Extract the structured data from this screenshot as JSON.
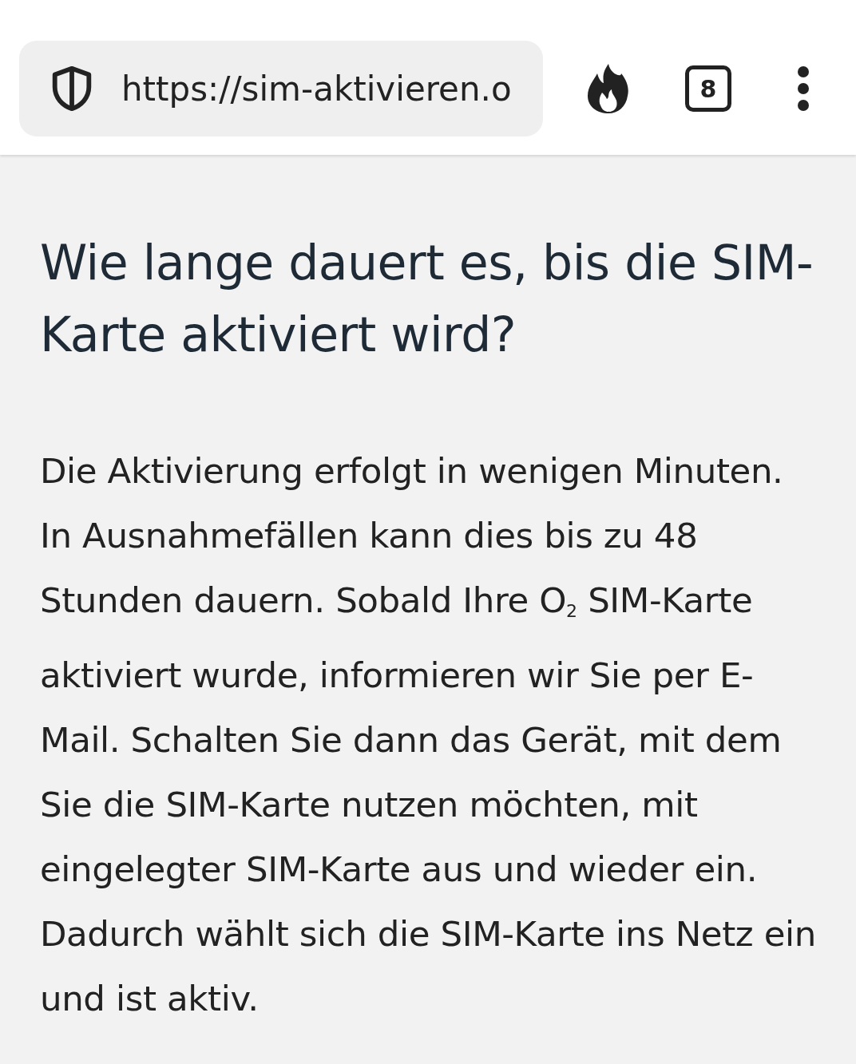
{
  "browser_bar": {
    "url": "https://sim-aktivieren.o",
    "tab_count": "8"
  },
  "article": {
    "heading": "Wie lange dauert es, bis die SIM-Karte aktiviert wird?",
    "paragraph": "Die Aktivierung erfolgt in wenigen Minuten. In Ausnahmefällen kann dies bis zu 48 Stunden dauern. Sobald Ihre O$_{2}$ SIM-Karte aktiviert wurde, informieren wir Sie per E-Mail. Schalten Sie dann das Gerät, mit dem Sie die SIM-Karte nutzen möchten, mit eingelegter SIM-Karte aus und wieder ein. Dadurch wählt sich die SIM-Karte ins Netz ein und ist aktiv."
  }
}
